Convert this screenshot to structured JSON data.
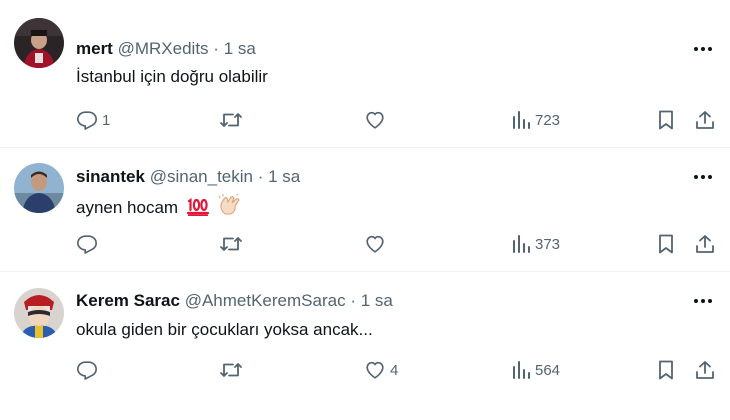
{
  "tweets": [
    {
      "name": "mert",
      "handle": "@MRXedits",
      "separator": "·",
      "time": "1 sa",
      "text": "İstanbul için doğru olabilir",
      "emojis": [],
      "counts": {
        "reply": "1",
        "retweet": "",
        "like": "",
        "views": "723"
      }
    },
    {
      "name": "sinantek",
      "handle": "@sinan_tekin",
      "separator": "·",
      "time": "1 sa",
      "text": "aynen hocam",
      "emojis": [
        "hundred-points",
        "clapping-hands"
      ],
      "counts": {
        "reply": "",
        "retweet": "",
        "like": "",
        "views": "373"
      }
    },
    {
      "name": "Kerem Sarac",
      "handle": "@AhmetKeremSarac",
      "separator": "·",
      "time": "1 sa",
      "text": "okula giden bir çocukları yoksa ancak...",
      "emojis": [],
      "counts": {
        "reply": "",
        "retweet": "",
        "like": "4",
        "views": "564"
      }
    }
  ],
  "icons": [
    "reply-icon",
    "retweet-icon",
    "like-icon",
    "views-icon",
    "bookmark-icon",
    "share-icon",
    "more-icon"
  ],
  "colors": {
    "text": "#0f1419",
    "secondary": "#536471",
    "divider": "#eff3f4"
  }
}
